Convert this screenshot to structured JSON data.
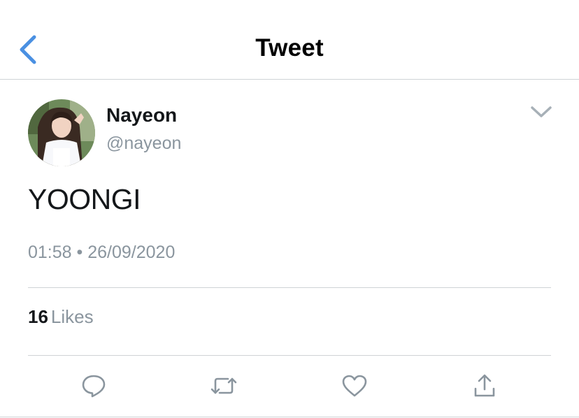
{
  "header": {
    "title": "Tweet",
    "back_icon": "chevron-left-icon"
  },
  "tweet": {
    "author": {
      "display_name": "Nayeon",
      "handle": "@nayeon"
    },
    "text": "YOONGI",
    "time": "01:58",
    "separator": "•",
    "date": "26/09/2020",
    "likes_count": "16",
    "likes_label": "Likes"
  },
  "actions": {
    "reply_icon": "reply-icon",
    "retweet_icon": "retweet-icon",
    "like_icon": "heart-icon",
    "share_icon": "share-icon"
  },
  "colors": {
    "accent": "#4a90e2",
    "text": "#14171a",
    "secondary": "#8a959e",
    "divider": "#cfd3d6"
  }
}
